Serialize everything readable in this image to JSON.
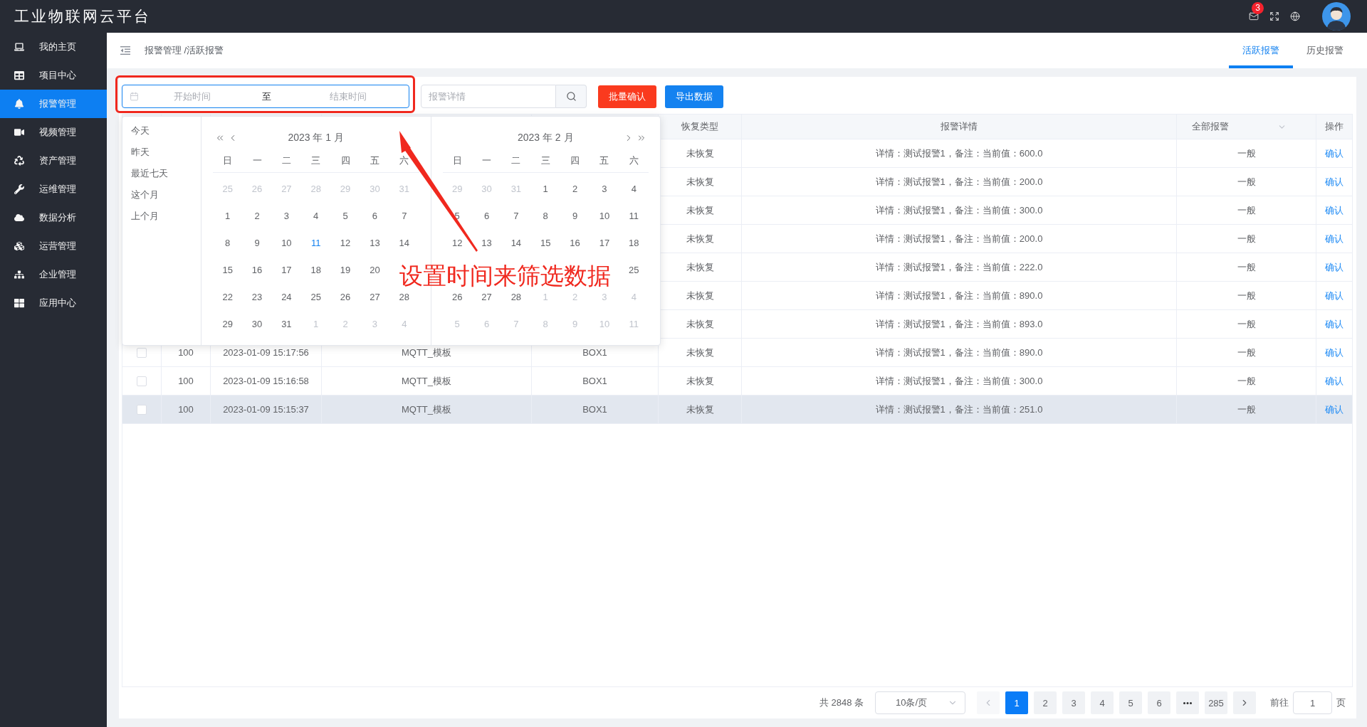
{
  "header": {
    "title": "工业物联网云平台",
    "mail_badge": "3"
  },
  "sidebar": {
    "items": [
      {
        "label": "我的主页",
        "selected": false
      },
      {
        "label": "项目中心",
        "selected": false
      },
      {
        "label": "报警管理",
        "selected": true
      },
      {
        "label": "视频管理",
        "selected": false
      },
      {
        "label": "资产管理",
        "selected": false
      },
      {
        "label": "运维管理",
        "selected": false
      },
      {
        "label": "数据分析",
        "selected": false
      },
      {
        "label": "运营管理",
        "selected": false
      },
      {
        "label": "企业管理",
        "selected": false
      },
      {
        "label": "应用中心",
        "selected": false
      }
    ]
  },
  "breadcrumb": "报警管理 /活跃报警",
  "tabs": [
    {
      "label": "活跃报警",
      "selected": true
    },
    {
      "label": "历史报警",
      "selected": false
    }
  ],
  "toolbar": {
    "date_range": {
      "start_placeholder": "开始时间",
      "separator": "至",
      "end_placeholder": "结束时间",
      "focused": true
    },
    "search": {
      "placeholder": "报警详情"
    },
    "buttons": [
      {
        "label": "批量确认",
        "kind": "danger"
      },
      {
        "label": "导出数据",
        "kind": "primary"
      }
    ]
  },
  "date_picker": {
    "shortcuts": [
      "今天",
      "昨天",
      "最近七天",
      "这个月",
      "上个月"
    ],
    "panels": [
      {
        "kind": "left",
        "title": "2023 年 1 月",
        "weekdays": [
          "日",
          "一",
          "二",
          "三",
          "四",
          "五",
          "六"
        ],
        "weeks": [
          [
            {
              "day": "25",
              "kind": "other"
            },
            {
              "day": "26",
              "kind": "other"
            },
            {
              "day": "27",
              "kind": "other"
            },
            {
              "day": "28",
              "kind": "other"
            },
            {
              "day": "29",
              "kind": "other"
            },
            {
              "day": "30",
              "kind": "other"
            },
            {
              "day": "31",
              "kind": "other"
            }
          ],
          [
            {
              "day": "1",
              "kind": "day"
            },
            {
              "day": "2",
              "kind": "day"
            },
            {
              "day": "3",
              "kind": "day"
            },
            {
              "day": "4",
              "kind": "day"
            },
            {
              "day": "5",
              "kind": "day"
            },
            {
              "day": "6",
              "kind": "day"
            },
            {
              "day": "7",
              "kind": "day"
            }
          ],
          [
            {
              "day": "8",
              "kind": "day"
            },
            {
              "day": "9",
              "kind": "day"
            },
            {
              "day": "10",
              "kind": "day"
            },
            {
              "day": "11",
              "kind": "today"
            },
            {
              "day": "12",
              "kind": "day"
            },
            {
              "day": "13",
              "kind": "day"
            },
            {
              "day": "14",
              "kind": "day"
            }
          ],
          [
            {
              "day": "15",
              "kind": "day"
            },
            {
              "day": "16",
              "kind": "day"
            },
            {
              "day": "17",
              "kind": "day"
            },
            {
              "day": "18",
              "kind": "day"
            },
            {
              "day": "19",
              "kind": "day"
            },
            {
              "day": "20",
              "kind": "day"
            },
            {
              "kind": "covered"
            }
          ],
          [
            {
              "day": "22",
              "kind": "day"
            },
            {
              "day": "23",
              "kind": "day"
            },
            {
              "day": "24",
              "kind": "day"
            },
            {
              "day": "25",
              "kind": "day"
            },
            {
              "day": "26",
              "kind": "day"
            },
            {
              "day": "27",
              "kind": "day"
            },
            {
              "day": "28",
              "kind": "day"
            }
          ],
          [
            {
              "day": "29",
              "kind": "day"
            },
            {
              "day": "30",
              "kind": "day"
            },
            {
              "day": "31",
              "kind": "day"
            },
            {
              "day": "1",
              "kind": "other"
            },
            {
              "day": "2",
              "kind": "other"
            },
            {
              "day": "3",
              "kind": "other"
            },
            {
              "day": "4",
              "kind": "other"
            }
          ]
        ]
      },
      {
        "kind": "right",
        "title": "2023 年 2 月",
        "weekdays": [
          "日",
          "一",
          "二",
          "三",
          "四",
          "五",
          "六"
        ],
        "weeks": [
          [
            {
              "day": "29",
              "kind": "other"
            },
            {
              "day": "30",
              "kind": "other"
            },
            {
              "day": "31",
              "kind": "other"
            },
            {
              "day": "1",
              "kind": "day"
            },
            {
              "day": "2",
              "kind": "day"
            },
            {
              "day": "3",
              "kind": "day"
            },
            {
              "day": "4",
              "kind": "day"
            }
          ],
          [
            {
              "day": "5",
              "kind": "day"
            },
            {
              "day": "6",
              "kind": "day"
            },
            {
              "day": "7",
              "kind": "day"
            },
            {
              "day": "8",
              "kind": "day"
            },
            {
              "day": "9",
              "kind": "day"
            },
            {
              "day": "10",
              "kind": "day"
            },
            {
              "day": "11",
              "kind": "day"
            }
          ],
          [
            {
              "day": "12",
              "kind": "day"
            },
            {
              "day": "13",
              "kind": "day"
            },
            {
              "day": "14",
              "kind": "day"
            },
            {
              "day": "15",
              "kind": "day"
            },
            {
              "day": "16",
              "kind": "day"
            },
            {
              "day": "17",
              "kind": "day"
            },
            {
              "day": "18",
              "kind": "day"
            }
          ],
          [
            {
              "kind": "covered"
            },
            {
              "kind": "covered"
            },
            {
              "kind": "covered"
            },
            {
              "kind": "covered"
            },
            {
              "kind": "covered"
            },
            {
              "kind": "covered"
            },
            {
              "day": "25",
              "kind": "day"
            }
          ],
          [
            {
              "day": "26",
              "kind": "day"
            },
            {
              "day": "27",
              "kind": "day"
            },
            {
              "day": "28",
              "kind": "day"
            },
            {
              "day": "1",
              "kind": "other"
            },
            {
              "day": "2",
              "kind": "other"
            },
            {
              "day": "3",
              "kind": "other"
            },
            {
              "day": "4",
              "kind": "other"
            }
          ],
          [
            {
              "day": "5",
              "kind": "other"
            },
            {
              "day": "6",
              "kind": "other"
            },
            {
              "day": "7",
              "kind": "other"
            },
            {
              "day": "8",
              "kind": "other"
            },
            {
              "day": "9",
              "kind": "other"
            },
            {
              "day": "10",
              "kind": "other"
            },
            {
              "day": "11",
              "kind": "other"
            }
          ]
        ]
      }
    ]
  },
  "annotation": {
    "text": "设置时间来筛选数据"
  },
  "table": {
    "columns": [
      {
        "label": "恢复类型",
        "kind": "text"
      },
      {
        "label": "报警详情",
        "kind": "text"
      },
      {
        "label": "全部报警",
        "kind": "select"
      },
      {
        "label": "操作",
        "kind": "text"
      }
    ],
    "rows": [
      {
        "recovery_type": "未恢复",
        "alarm_detail": "详情：测试报警1，备注：当前值：600.0",
        "alarm_grade": "一般",
        "action": "确认",
        "hovered": false
      },
      {
        "recovery_type": "未恢复",
        "alarm_detail": "详情：测试报警1，备注：当前值：200.0",
        "alarm_grade": "一般",
        "action": "确认",
        "hovered": false
      },
      {
        "recovery_type": "未恢复",
        "alarm_detail": "详情：测试报警1，备注：当前值：300.0",
        "alarm_grade": "一般",
        "action": "确认",
        "hovered": false
      },
      {
        "recovery_type": "未恢复",
        "alarm_detail": "详情：测试报警1，备注：当前值：200.0",
        "alarm_grade": "一般",
        "action": "确认",
        "hovered": false
      },
      {
        "recovery_type": "未恢复",
        "alarm_detail": "详情：测试报警1，备注：当前值：222.0",
        "alarm_grade": "一般",
        "action": "确认",
        "hovered": false
      },
      {
        "recovery_type": "未恢复",
        "alarm_detail": "详情：测试报警1，备注：当前值：890.0",
        "alarm_grade": "一般",
        "action": "确认",
        "hovered": false
      },
      {
        "recovery_type": "未恢复",
        "alarm_detail": "详情：测试报警1，备注：当前值：893.0",
        "alarm_grade": "一般",
        "action": "确认",
        "hovered": false
      },
      {
        "checked": false,
        "column_2": "100",
        "column_3": "2023-01-09 15:17:56",
        "column_4": "MQTT_模板",
        "column_5": "BOX1",
        "recovery_type": "未恢复",
        "alarm_detail": "详情：测试报警1，备注：当前值：890.0",
        "alarm_grade": "一般",
        "action": "确认",
        "hovered": false
      },
      {
        "checked": false,
        "column_2": "100",
        "column_3": "2023-01-09 15:16:58",
        "column_4": "MQTT_模板",
        "column_5": "BOX1",
        "recovery_type": "未恢复",
        "alarm_detail": "详情：测试报警1，备注：当前值：300.0",
        "alarm_grade": "一般",
        "action": "确认",
        "hovered": false
      },
      {
        "checked": false,
        "column_2": "100",
        "column_3": "2023-01-09 15:15:37",
        "column_4": "MQTT_模板",
        "column_5": "BOX1",
        "recovery_type": "未恢复",
        "alarm_detail": "详情：测试报警1，备注：当前值：251.0",
        "alarm_grade": "一般",
        "action": "确认",
        "hovered": true
      }
    ]
  },
  "pagination": {
    "total": "共 2848 条",
    "page_size": "10条/页",
    "prev_disabled": true,
    "next_disabled": false,
    "pages": [
      {
        "label": "1",
        "kind": "page",
        "selected": true
      },
      {
        "label": "2",
        "kind": "page",
        "selected": false
      },
      {
        "label": "3",
        "kind": "page",
        "selected": false
      },
      {
        "label": "4",
        "kind": "page",
        "selected": false
      },
      {
        "label": "5",
        "kind": "page",
        "selected": false
      },
      {
        "label": "6",
        "kind": "page",
        "selected": false
      },
      {
        "kind": "more",
        "selected": false
      },
      {
        "label": "285",
        "kind": "page",
        "selected": false
      }
    ],
    "jump_label": "前往",
    "jump_value": "1",
    "jump_suffix": "页"
  }
}
